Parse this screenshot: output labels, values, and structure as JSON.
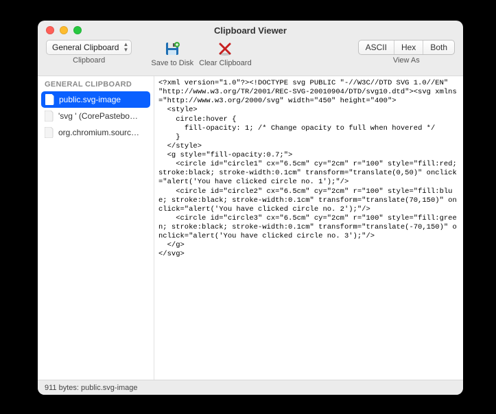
{
  "window": {
    "title": "Clipboard Viewer"
  },
  "toolbar": {
    "clipboard_select": {
      "label": "General Clipboard",
      "group_label": "Clipboard"
    },
    "save_label": "Save to Disk",
    "clear_label": "Clear Clipboard",
    "view_as_label": "View As",
    "seg": {
      "ascii": "ASCII",
      "hex": "Hex",
      "both": "Both"
    }
  },
  "sidebar": {
    "header": "GENERAL CLIPBOARD",
    "items": [
      {
        "label": "public.svg-image",
        "selected": true
      },
      {
        "label": "'svg ' (CorePastebo…",
        "selected": false
      },
      {
        "label": "org.chromium.sourc…",
        "selected": false
      }
    ]
  },
  "content": "<?xml version=\"1.0\"?><!DOCTYPE svg PUBLIC \"-//W3C//DTD SVG 1.0//EN\" \"http://www.w3.org/TR/2001/REC-SVG-20010904/DTD/svg10.dtd\"><svg xmlns=\"http://www.w3.org/2000/svg\" width=\"450\" height=\"400\">\n  <style>\n    circle:hover {\n      fill-opacity: 1; /* Change opacity to full when hovered */\n    }\n  </style>\n  <g style=\"fill-opacity:0.7;\">\n    <circle id=\"circle1\" cx=\"6.5cm\" cy=\"2cm\" r=\"100\" style=\"fill:red; stroke:black; stroke-width:0.1cm\" transform=\"translate(0,50)\" onclick=\"alert('You have clicked circle no. 1');\"/>\n    <circle id=\"circle2\" cx=\"6.5cm\" cy=\"2cm\" r=\"100\" style=\"fill:blue; stroke:black; stroke-width:0.1cm\" transform=\"translate(70,150)\" onclick=\"alert('You have clicked circle no. 2');\"/>\n    <circle id=\"circle3\" cx=\"6.5cm\" cy=\"2cm\" r=\"100\" style=\"fill:green; stroke:black; stroke-width:0.1cm\" transform=\"translate(-70,150)\" onclick=\"alert('You have clicked circle no. 3');\"/>\n  </g>\n</svg>",
  "status": "911 bytes: public.svg-image"
}
